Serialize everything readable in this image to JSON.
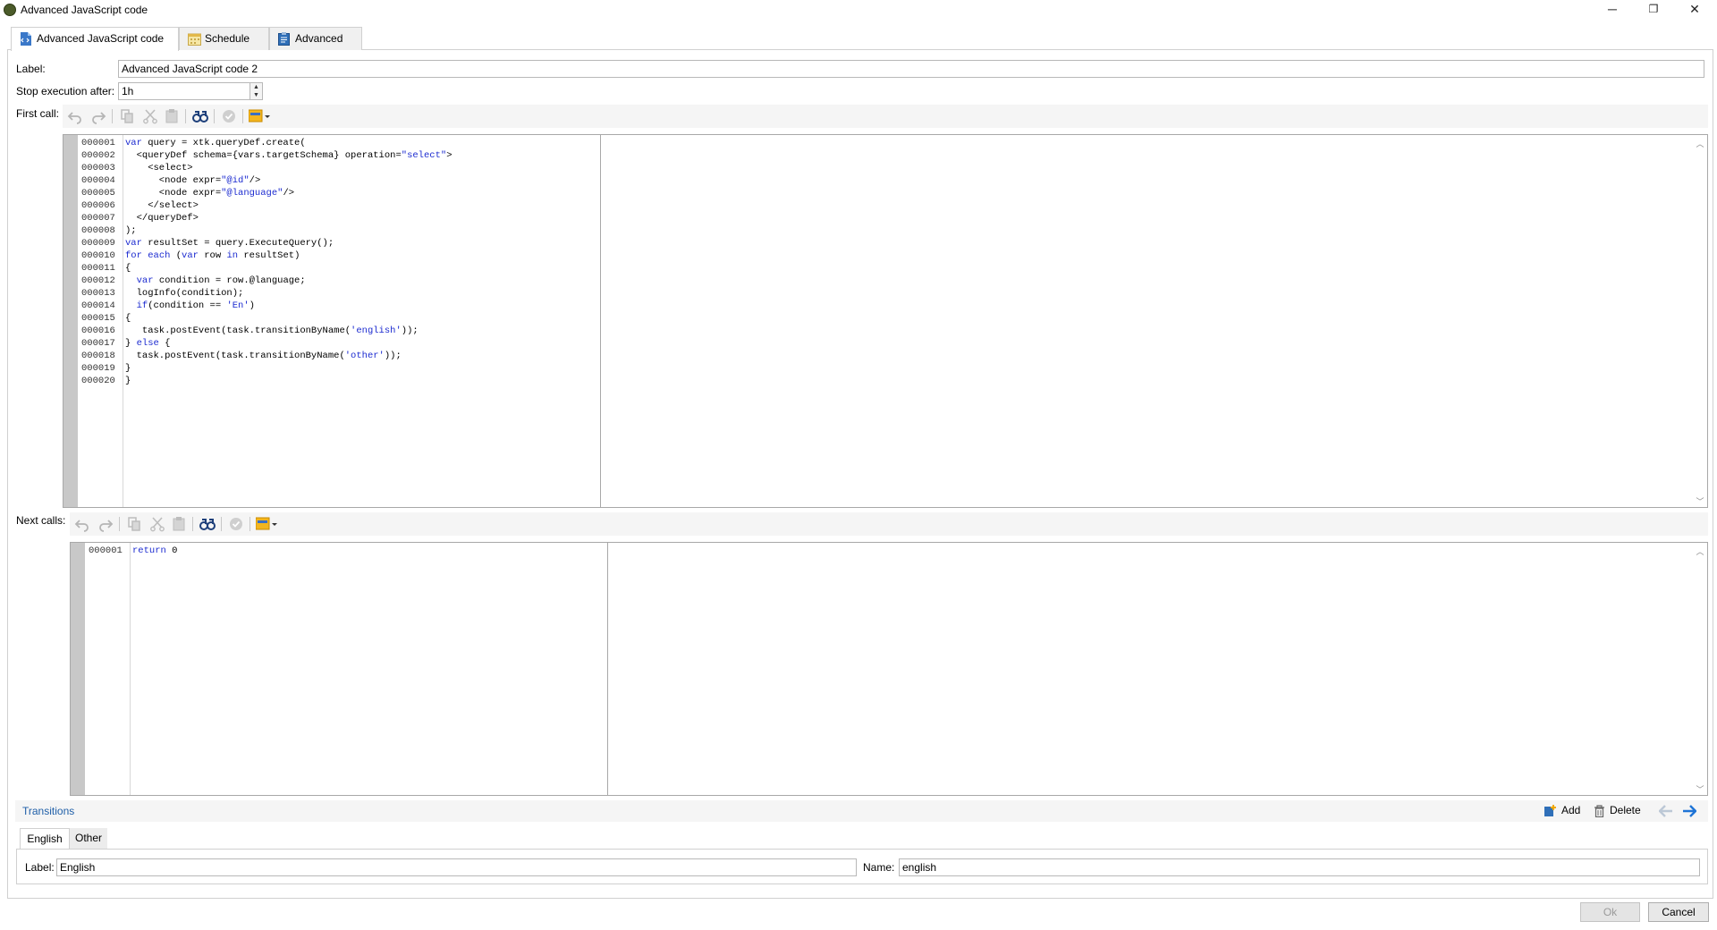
{
  "window": {
    "title": "Advanced JavaScript code",
    "minimize_glyph": "─",
    "restore_glyph": "❐",
    "close_glyph": "✕"
  },
  "tabs": [
    {
      "label": "Advanced JavaScript code",
      "icon": "script-icon",
      "active": true
    },
    {
      "label": "Schedule",
      "icon": "calendar-icon",
      "active": false
    },
    {
      "label": "Advanced",
      "icon": "clipboard-icon",
      "active": false
    }
  ],
  "form": {
    "label_caption": "Label:",
    "label_value": "Advanced JavaScript code 2",
    "stop_caption": "Stop execution after:",
    "stop_value": "1h",
    "first_call_caption": "First call:",
    "next_calls_caption": "Next calls:"
  },
  "first_call": {
    "line_numbers": "000001\n000002\n000003\n000004\n000005\n000006\n000007\n000008\n000009\n000010\n000011\n000012\n000013\n000014\n000015\n000016\n000017\n000018\n000019\n000020",
    "code_lines": [
      "var query = xtk.queryDef.create(",
      "  <queryDef schema={vars.targetSchema} operation=\"select\">",
      "    <select>",
      "      <node expr=\"@id\"/>",
      "      <node expr=\"@language\"/>",
      "    </select>",
      "  </queryDef>",
      ");",
      "var resultSet = query.ExecuteQuery();",
      "for each (var row in resultSet)",
      "{",
      "  var condition = row.@language;",
      "  logInfo(condition);",
      "  if(condition == 'En')",
      "{",
      "   task.postEvent(task.transitionByName('english'));",
      "} else {",
      "  task.postEvent(task.transitionByName('other'));",
      "}",
      "}"
    ]
  },
  "next_calls": {
    "line_numbers": "000001",
    "code_lines": [
      "return 0"
    ]
  },
  "transitions": {
    "title": "Transitions",
    "add_label": "Add",
    "delete_label": "Delete",
    "tabs": [
      {
        "label": "English",
        "active": true
      },
      {
        "label": "Other",
        "active": false
      }
    ],
    "label_caption": "Label:",
    "label_value": "English",
    "name_caption": "Name:",
    "name_value": "english"
  },
  "buttons": {
    "ok_label": "Ok",
    "cancel_label": "Cancel"
  },
  "colors": {
    "keyword": "#1c2bd0",
    "link": "#1f5fa8",
    "arrow_active": "#1e74d6"
  }
}
